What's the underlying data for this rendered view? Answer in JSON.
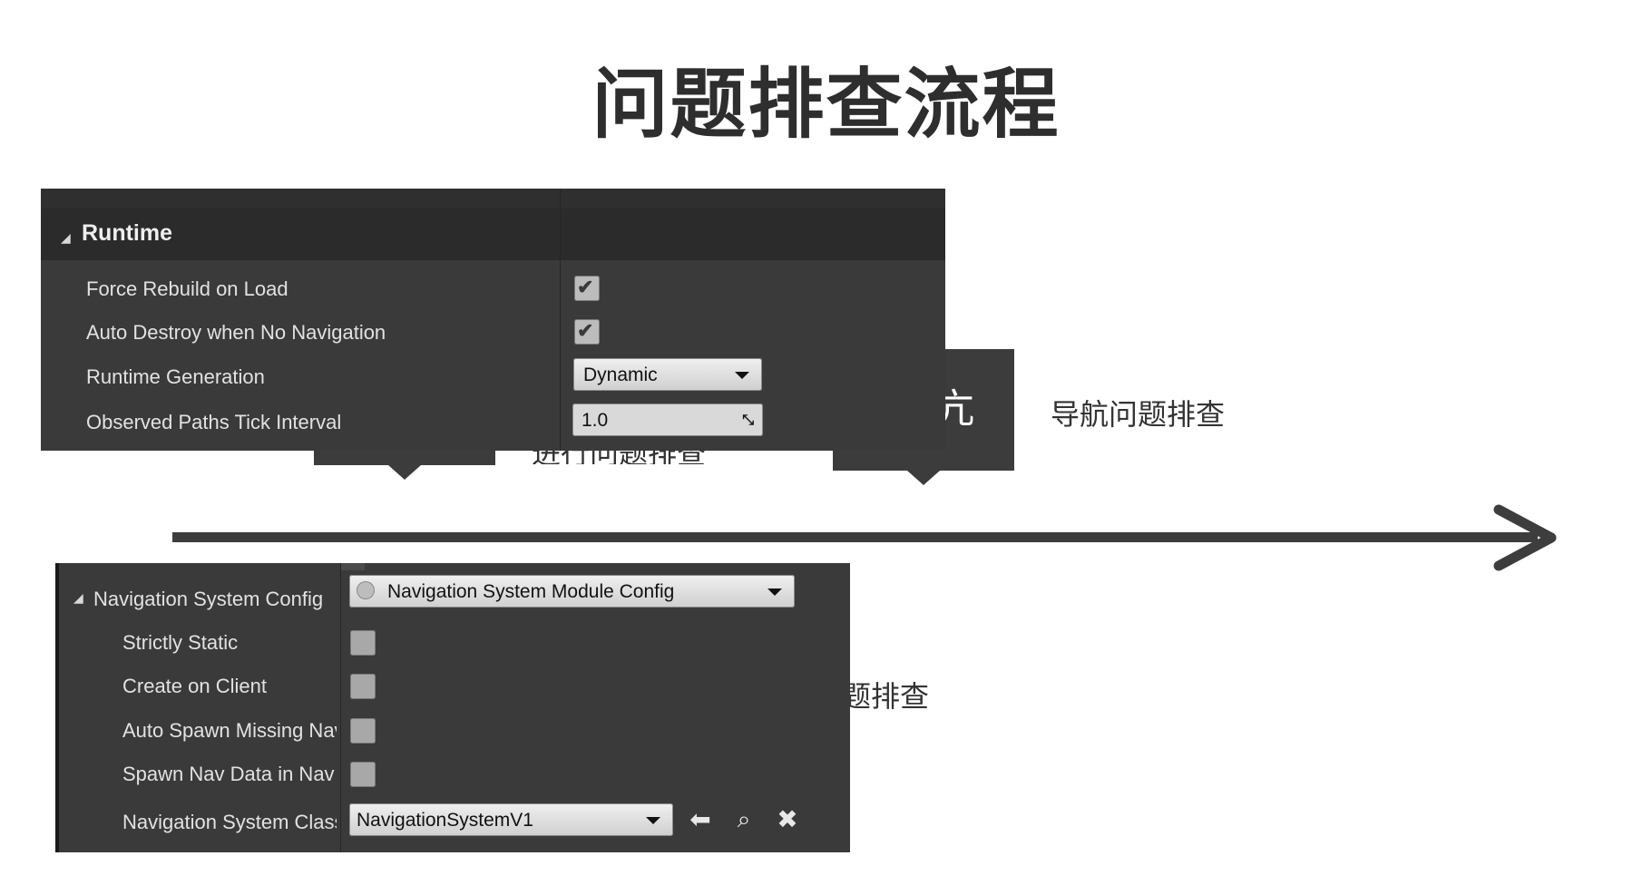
{
  "slide": {
    "title": "问题排查流程",
    "caption_right": "导航问题排查",
    "caption_left_partial": "进行问题排查",
    "caption_bottom_partial": "题排查",
    "step_box_right_text": "亢"
  },
  "runtime_panel": {
    "category": "Runtime",
    "rows": [
      {
        "label": "Force Rebuild on Load",
        "control": "checkbox",
        "checked": true
      },
      {
        "label": "Auto Destroy when No Navigation",
        "control": "checkbox",
        "checked": true
      },
      {
        "label": "Runtime Generation",
        "control": "dropdown",
        "value": "Dynamic"
      },
      {
        "label": "Observed Paths Tick Interval",
        "control": "number",
        "value": "1.0"
      }
    ]
  },
  "nav_panel": {
    "category": "Navigation System Config",
    "category_value": "Navigation System Module Config",
    "rows": [
      {
        "label": "Strictly Static",
        "checked": false
      },
      {
        "label": "Create on Client",
        "checked": false
      },
      {
        "label": "Auto Spawn Missing Navigation Data",
        "checked": false
      },
      {
        "label": "Spawn Nav Data in Nav Bounds Level",
        "checked": false
      }
    ],
    "class_row": {
      "label": "Navigation System Class",
      "value": "NavigationSystemV1",
      "icons": [
        "use-selected-arrow-icon",
        "browse-search-icon",
        "clear-x-icon"
      ]
    }
  },
  "colors": {
    "panel_bg": "#3a3a3a",
    "header_bg": "#2b2b2b",
    "timeline": "#3d3d3d"
  }
}
